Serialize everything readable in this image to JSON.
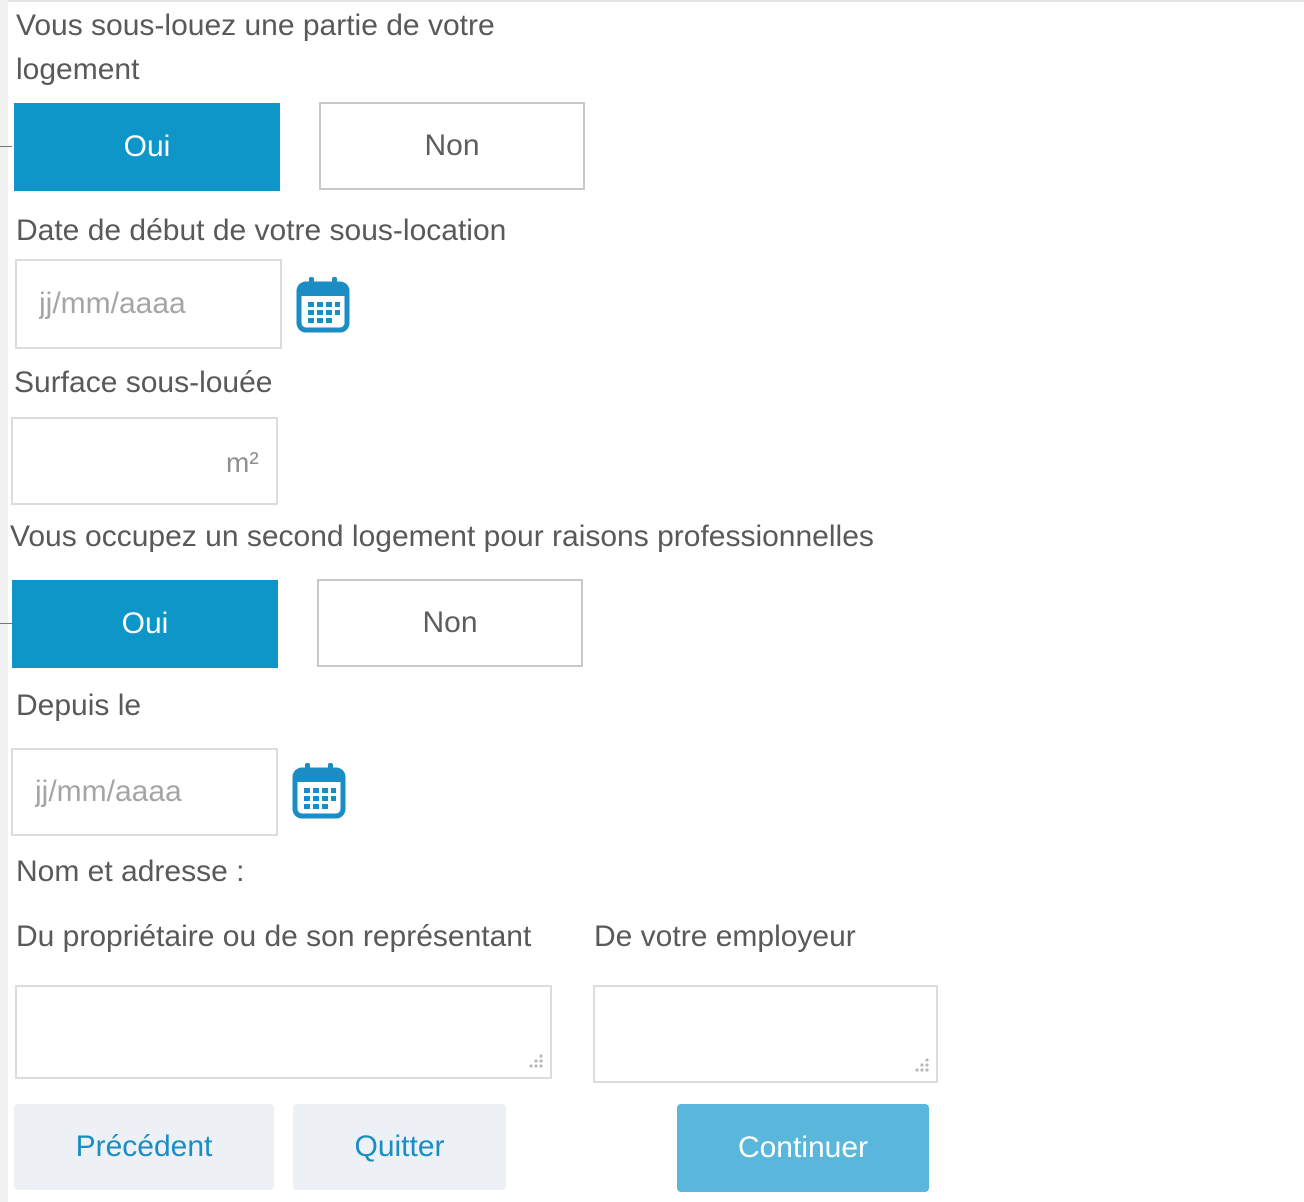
{
  "sublet": {
    "question_line1": "Vous sous-louez une partie de votre",
    "question_line2": "logement",
    "yes_label": "Oui",
    "no_label": "Non",
    "selected": "Oui"
  },
  "sublet_start": {
    "label": "Date de début de votre sous-location",
    "placeholder": "jj/mm/aaaa",
    "value": ""
  },
  "sublet_surface": {
    "label": "Surface sous-louée",
    "unit": "m²",
    "value": ""
  },
  "second_home": {
    "question": "Vous occupez un second logement pour raisons professionnelles",
    "yes_label": "Oui",
    "no_label": "Non",
    "selected": "Oui"
  },
  "since": {
    "label": "Depuis le",
    "placeholder": "jj/mm/aaaa",
    "value": ""
  },
  "name_address": {
    "heading": "Nom et adresse :",
    "owner_label": "Du propriétaire ou de son représentant",
    "employer_label": "De votre employeur"
  },
  "actions": {
    "previous_label": "Précédent",
    "quit_label": "Quitter",
    "continue_label": "Continuer"
  },
  "icons": {
    "calendar": "calendar-icon",
    "resize": "resize-grip-icon"
  },
  "colors": {
    "accent": "#0f96c8",
    "continue": "#58b7da",
    "secondary_bg": "#edf0f5",
    "secondary_text": "#1a8ec4",
    "label_text": "#595959"
  }
}
